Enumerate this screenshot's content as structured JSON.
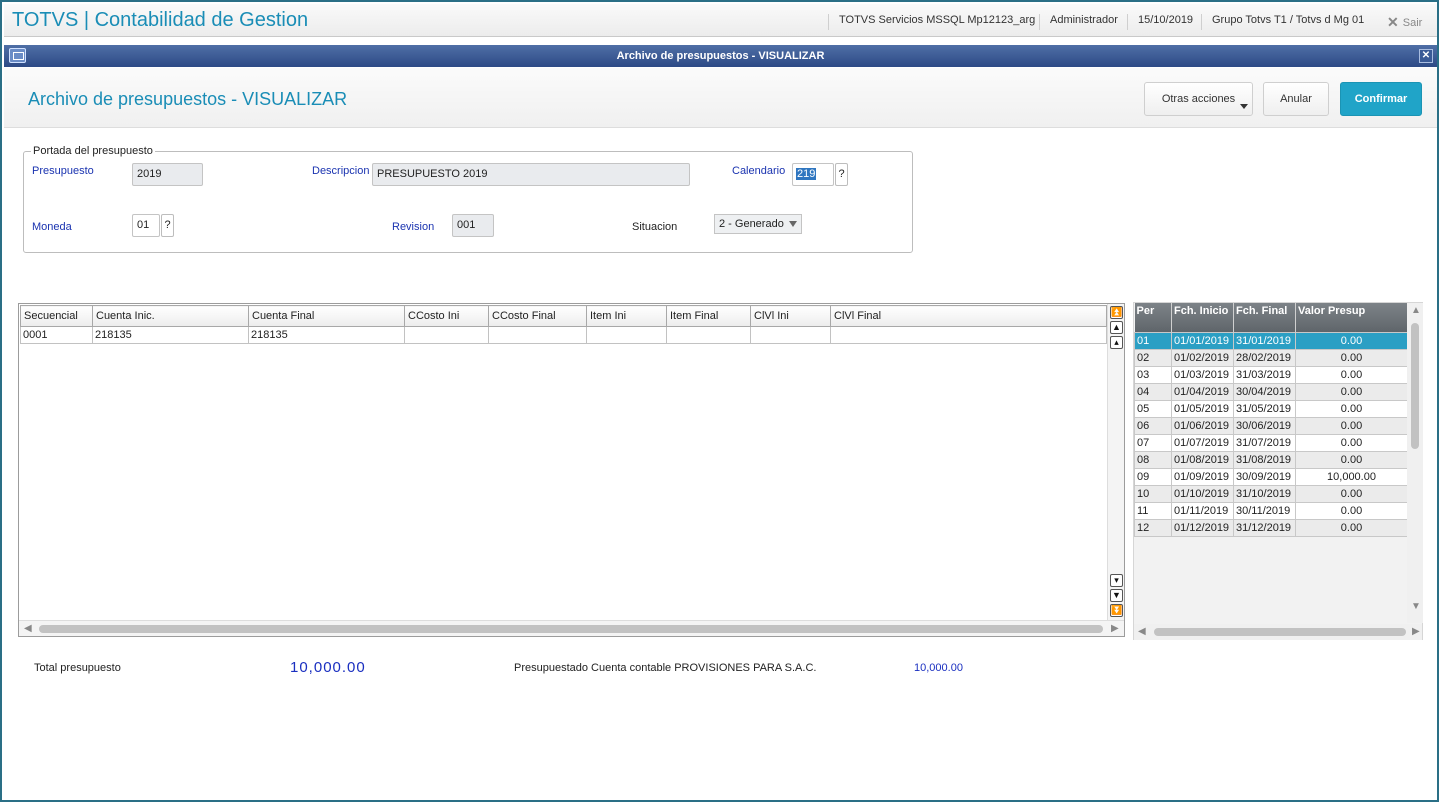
{
  "app": {
    "title": "TOTVS | Contabilidad de Gestion",
    "server": "TOTVS Servicios MSSQL Mp12123_arg",
    "user": "Administrador",
    "date": "15/10/2019",
    "group": "Grupo Totvs T1 / Totvs d Mg 01",
    "exit_label": "Sair"
  },
  "dialog": {
    "title": "Archivo de presupuestos - VISUALIZAR"
  },
  "header": {
    "title": "Archivo de presupuestos - VISUALIZAR",
    "more_actions_label": "Otras acciones",
    "cancel_label": "Anular",
    "confirm_label": "Confirmar"
  },
  "cover": {
    "legend": "Portada del presupuesto",
    "budget_label": "Presupuesto",
    "budget_value": "2019",
    "description_label": "Descripcion",
    "description_value": "PRESUPUESTO 2019",
    "calendar_label": "Calendario",
    "calendar_value": "219",
    "currency_label": "Moneda",
    "currency_value": "01",
    "revision_label": "Revision",
    "revision_value": "001",
    "status_label": "Situacion",
    "status_value": "2 - Generado",
    "lookup_label": "?"
  },
  "accounts_grid": {
    "columns": [
      "Secuencial",
      "Cuenta Inic.",
      "Cuenta Final",
      "CCosto Ini",
      "CCosto Final",
      "Item Ini",
      "Item Final",
      "ClVl Ini",
      "ClVl Final"
    ],
    "rows": [
      [
        "0001",
        "218135",
        "218135",
        "",
        "",
        "",
        "",
        "",
        ""
      ]
    ]
  },
  "periods_grid": {
    "columns": [
      "Per",
      "Fch. Inicio",
      "Fch. Final",
      "Valor Presup"
    ],
    "rows": [
      [
        "01",
        "01/01/2019",
        "31/01/2019",
        "0.00"
      ],
      [
        "02",
        "01/02/2019",
        "28/02/2019",
        "0.00"
      ],
      [
        "03",
        "01/03/2019",
        "31/03/2019",
        "0.00"
      ],
      [
        "04",
        "01/04/2019",
        "30/04/2019",
        "0.00"
      ],
      [
        "05",
        "01/05/2019",
        "31/05/2019",
        "0.00"
      ],
      [
        "06",
        "01/06/2019",
        "30/06/2019",
        "0.00"
      ],
      [
        "07",
        "01/07/2019",
        "31/07/2019",
        "0.00"
      ],
      [
        "08",
        "01/08/2019",
        "31/08/2019",
        "0.00"
      ],
      [
        "09",
        "01/09/2019",
        "30/09/2019",
        "10,000.00"
      ],
      [
        "10",
        "01/10/2019",
        "31/10/2019",
        "0.00"
      ],
      [
        "11",
        "01/11/2019",
        "30/11/2019",
        "0.00"
      ],
      [
        "12",
        "01/12/2019",
        "31/12/2019",
        "0.00"
      ]
    ],
    "selected_row": "01"
  },
  "totals": {
    "total_label": "Total presupuesto",
    "total_value": "10,000.00",
    "account_label": "Presupuestado Cuenta contable PROVISIONES PARA S.A.C.",
    "account_value": "10,000.00"
  },
  "colors": {
    "accent": "#1a8db6",
    "confirm_button": "#20a4c8",
    "selected_row": "#2b9fc4",
    "label_blue": "#1a33b0"
  }
}
